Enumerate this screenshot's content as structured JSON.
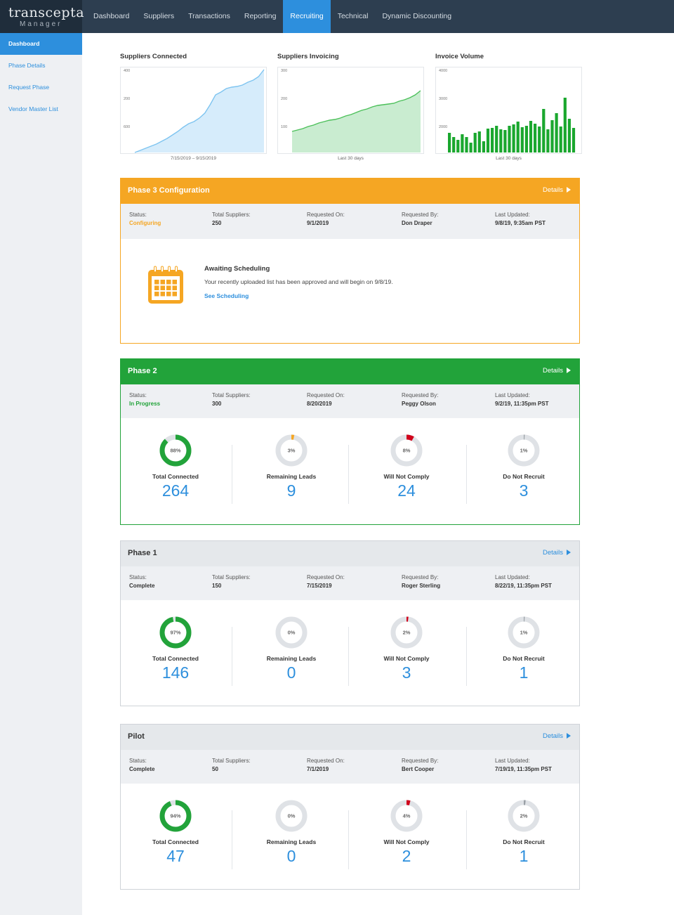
{
  "app": {
    "logo_main": "transcepta",
    "logo_sub": "Manager"
  },
  "nav": [
    "Dashboard",
    "Suppliers",
    "Transactions",
    "Reporting",
    "Recruiting",
    "Technical",
    "Dynamic Discounting"
  ],
  "nav_active": "Recruiting",
  "sidebar": [
    "Dashboard",
    "Phase Details",
    "Request Phase",
    "Vendor Master List"
  ],
  "sidebar_active": "Dashboard",
  "colors": {
    "blue": "#2d8fdd",
    "green": "#22a33a",
    "orange": "#f5a623",
    "red": "#d0021b",
    "grey": "#dfe2e6"
  },
  "chart_data": [
    {
      "type": "area",
      "title": "Suppliers Connected",
      "xlabel": "7/15/2019 – 9/15/2019",
      "ytick_labels": [
        "400",
        "200",
        "600"
      ],
      "color": "#7ec4f0",
      "values": [
        0,
        3,
        6,
        9,
        12,
        16,
        20,
        25,
        30,
        36,
        41,
        44,
        49,
        56,
        68,
        82,
        86,
        91,
        93,
        94,
        96,
        100,
        103,
        108,
        118
      ]
    },
    {
      "type": "area",
      "title": "Suppliers Invoicing",
      "xlabel": "Last 30 days",
      "ytick_labels": [
        "300",
        "200",
        "100"
      ],
      "color": "#4cc05a",
      "values": [
        30,
        32,
        34,
        37,
        39,
        42,
        44,
        46,
        47,
        49,
        52,
        54,
        57,
        60,
        62,
        65,
        67,
        68,
        69,
        70,
        73,
        75,
        78,
        82,
        88
      ]
    },
    {
      "type": "bar",
      "title": "Invoice Volume",
      "xlabel": "Last 30 days",
      "ytick_labels": [
        "4000",
        "3000",
        "2000"
      ],
      "color": "#1aa72e",
      "values": [
        28,
        22,
        18,
        26,
        22,
        14,
        28,
        30,
        16,
        34,
        35,
        38,
        33,
        32,
        38,
        40,
        44,
        36,
        38,
        45,
        41,
        37,
        62,
        33,
        46,
        56,
        37,
        78,
        48,
        35
      ]
    }
  ],
  "phases": [
    {
      "kind": "awaiting",
      "title": "Phase 3 Configuration",
      "details": "Details",
      "info": [
        {
          "label": "Status:",
          "value": "Configuring"
        },
        {
          "label": "Total Suppliers:",
          "value": "250"
        },
        {
          "label": "Requested On:",
          "value": "9/1/2019"
        },
        {
          "label": "Requested By:",
          "value": "Don Draper"
        },
        {
          "label": "Last Updated:",
          "value": "9/8/19, 9:35am PST"
        }
      ],
      "await_title": "Awaiting Scheduling",
      "await_text": "Your recently uploaded list has been approved and will begin on 9/8/19.",
      "await_link": "See Scheduling"
    },
    {
      "kind": "stats",
      "title": "Phase 2",
      "details": "Details",
      "info": [
        {
          "label": "Status:",
          "value": "In Progress"
        },
        {
          "label": "Total Suppliers:",
          "value": "300"
        },
        {
          "label": "Requested On:",
          "value": "8/20/2019"
        },
        {
          "label": "Requested By:",
          "value": "Peggy Olson"
        },
        {
          "label": "Last Updated:",
          "value": "9/2/19, 11:35pm PST"
        }
      ],
      "stats": [
        {
          "label": "Total Connected",
          "pct_label": "88%",
          "pct": 88,
          "color": "#22a33a",
          "count": "264"
        },
        {
          "label": "Remaining Leads",
          "pct_label": "3%",
          "pct": 3,
          "color": "#f5a623",
          "count": "9"
        },
        {
          "label": "Will Not Comply",
          "pct_label": "8%",
          "pct": 8,
          "color": "#d0021b",
          "count": "24"
        },
        {
          "label": "Do Not Recruit",
          "pct_label": "1%",
          "pct": 1,
          "color": "#9aa0a6",
          "count": "3"
        }
      ]
    },
    {
      "kind": "stats",
      "title": "Phase 1",
      "details": "Details",
      "info": [
        {
          "label": "Status:",
          "value": "Complete"
        },
        {
          "label": "Total Suppliers:",
          "value": "150"
        },
        {
          "label": "Requested On:",
          "value": "7/15/2019"
        },
        {
          "label": "Requested By:",
          "value": "Roger Sterling"
        },
        {
          "label": "Last Updated:",
          "value": "8/22/19, 11:35pm PST"
        }
      ],
      "stats": [
        {
          "label": "Total Connected",
          "pct_label": "97%",
          "pct": 97,
          "color": "#22a33a",
          "count": "146"
        },
        {
          "label": "Remaining Leads",
          "pct_label": "0%",
          "pct": 0,
          "color": "#f5a623",
          "count": "0"
        },
        {
          "label": "Will Not Comply",
          "pct_label": "2%",
          "pct": 2,
          "color": "#d0021b",
          "count": "3"
        },
        {
          "label": "Do Not Recruit",
          "pct_label": "1%",
          "pct": 1,
          "color": "#9aa0a6",
          "count": "1"
        }
      ]
    },
    {
      "kind": "stats",
      "title": "Pilot",
      "details": "Details",
      "info": [
        {
          "label": "Status:",
          "value": "Complete"
        },
        {
          "label": "Total Suppliers:",
          "value": "50"
        },
        {
          "label": "Requested On:",
          "value": "7/1/2019"
        },
        {
          "label": "Requested By:",
          "value": "Bert Cooper"
        },
        {
          "label": "Last Updated:",
          "value": "7/19/19, 11:35pm PST"
        }
      ],
      "stats": [
        {
          "label": "Total Connected",
          "pct_label": "94%",
          "pct": 94,
          "color": "#22a33a",
          "count": "47"
        },
        {
          "label": "Remaining Leads",
          "pct_label": "0%",
          "pct": 0,
          "color": "#f5a623",
          "count": "0"
        },
        {
          "label": "Will Not Comply",
          "pct_label": "4%",
          "pct": 4,
          "color": "#d0021b",
          "count": "2"
        },
        {
          "label": "Do Not Recruit",
          "pct_label": "2%",
          "pct": 2,
          "color": "#9aa0a6",
          "count": "1"
        }
      ]
    }
  ]
}
